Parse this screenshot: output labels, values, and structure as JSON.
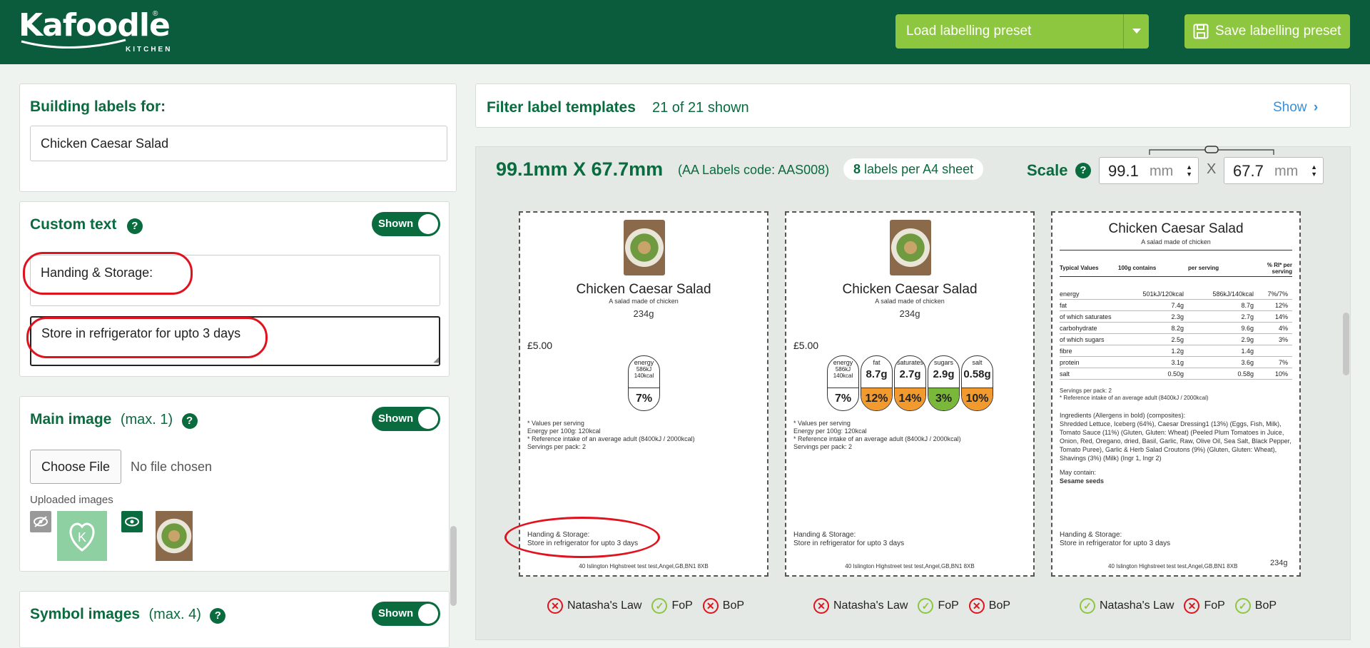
{
  "header": {
    "logo_text": "Kafoodle",
    "logo_sub": "KITCHEN",
    "load_preset_label": "Load labelling preset",
    "save_preset_label": "Save labelling preset"
  },
  "sidebar": {
    "building": {
      "title": "Building labels for:",
      "value": "Chicken Caesar Salad"
    },
    "custom_text": {
      "title": "Custom text",
      "toggle": "Shown",
      "line1": "Handing & Storage:",
      "line2": "Store in refrigerator for upto 3 days"
    },
    "main_image": {
      "title": "Main image",
      "max": "(max. 1)",
      "toggle": "Shown",
      "choose_file": "Choose File",
      "no_file": "No file chosen",
      "uploaded_label": "Uploaded images"
    },
    "symbol_images": {
      "title": "Symbol images",
      "max": "(max. 4)",
      "toggle": "Shown"
    }
  },
  "filter": {
    "title": "Filter label templates",
    "count": "21 of 21 shown",
    "show": "Show"
  },
  "label_sheet": {
    "size": "99.1mm X 67.7mm",
    "code": "(AA Labels code: AAS008)",
    "per_sheet_num": "8",
    "per_sheet_text": "labels per A4 sheet",
    "scale_label": "Scale",
    "width_value": "99.1",
    "height_value": "67.7",
    "unit": "mm",
    "x_sep": "X"
  },
  "label": {
    "title": "Chicken Caesar Salad",
    "subtitle": "A salad made of chicken",
    "weight": "234g",
    "price": "£5.00",
    "notes": [
      "* Values per serving",
      "Energy per 100g: 120kcal",
      "* Reference intake of an average adult (8400kJ / 2000kcal)",
      "Servings per pack: 2"
    ],
    "handling": "Handing & Storage:",
    "storage": "Store in refrigerator for upto 3 days",
    "address": "40 Islington Highstreet test test,Angel,GB,BN1 8XB"
  },
  "traffic": {
    "energy": {
      "name": "energy",
      "kj": "586kJ",
      "kcal": "140kcal",
      "pct": "7%"
    },
    "items": [
      {
        "name": "fat",
        "value": "8.7g",
        "pct": "12%",
        "color": "#f29a2e"
      },
      {
        "name": "saturates",
        "value": "2.7g",
        "pct": "14%",
        "color": "#f29a2e"
      },
      {
        "name": "sugars",
        "value": "2.9g",
        "pct": "3%",
        "color": "#7ab83a"
      },
      {
        "name": "salt",
        "value": "0.58g",
        "pct": "10%",
        "color": "#f29a2e"
      }
    ]
  },
  "nutrition": {
    "headers": [
      "Typical Values",
      "100g contains",
      "per serving",
      "% RI* per serving"
    ],
    "rows": [
      [
        "energy",
        "501kJ/120kcal",
        "586kJ/140kcal",
        "7%/7%"
      ],
      [
        "fat",
        "7.4g",
        "8.7g",
        "12%"
      ],
      [
        "of which saturates",
        "2.3g",
        "2.7g",
        "14%"
      ],
      [
        "carbohydrate",
        "8.2g",
        "9.6g",
        "4%"
      ],
      [
        "of which sugars",
        "2.5g",
        "2.9g",
        "3%"
      ],
      [
        "fibre",
        "1.2g",
        "1.4g",
        ""
      ],
      [
        "protein",
        "3.1g",
        "3.6g",
        "7%"
      ],
      [
        "salt",
        "0.50g",
        "0.58g",
        "10%"
      ]
    ],
    "servings": "Servings per pack: 2",
    "ri_note": "* Reference intake of an average adult (8400kJ / 2000kcal)",
    "ingredients_title": "Ingredients (Allergens in bold) (composites):",
    "ingredients_text": "Shredded Lettuce, Iceberg (64%), Caesar Dressing1 (13%) (Eggs, Fish, Milk), Tomato Sauce (11%) (Gluten, Gluten: Wheat) (Peeled Plum Tomatoes in Juice, Onion, Red, Oregano, dried, Basil, Garlic, Raw, Olive Oil, Sea Salt, Black Pepper, Tomato Puree), Garlic & Herb Salad Croutons (9%) (Gluten, Gluten: Wheat), Shavings (3%) (Milk) (Ingr 1, Ingr 2)",
    "may_contain": "May contain:",
    "may_contain_value": "Sesame seeds"
  },
  "indicators": [
    {
      "law": "fail",
      "fop": "pass",
      "bop": "fail"
    },
    {
      "law": "fail",
      "fop": "pass",
      "bop": "fail"
    },
    {
      "law": "pass",
      "fop": "fail",
      "bop": "pass"
    }
  ],
  "indicator_labels": {
    "law": "Natasha's Law",
    "fop": "FoP",
    "bop": "BoP"
  },
  "colors": {
    "brand": "#0a5c3c",
    "accent": "#8dc63f",
    "highlight": "#e0121d"
  }
}
